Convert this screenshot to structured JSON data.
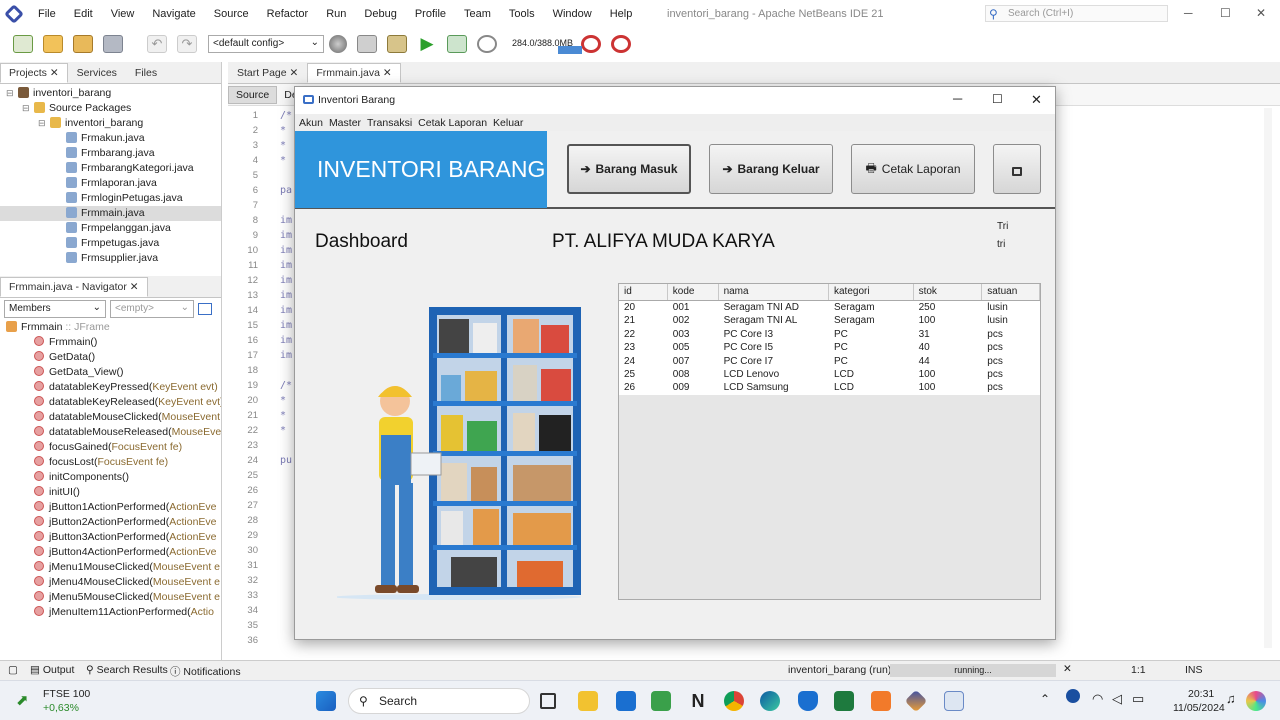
{
  "ide": {
    "menu": [
      "File",
      "Edit",
      "View",
      "Navigate",
      "Source",
      "Refactor",
      "Run",
      "Debug",
      "Profile",
      "Team",
      "Tools",
      "Window",
      "Help"
    ],
    "window_title": "inventori_barang - Apache NetBeans IDE 21",
    "search_placeholder": "Search (Ctrl+I)",
    "config": "<default config>",
    "memory": "284.0/388.0MB"
  },
  "projects_panel": {
    "tabs": [
      "Projects",
      "Services",
      "Files"
    ],
    "tree": [
      {
        "label": "inventori_barang",
        "indent": 0,
        "type": "project"
      },
      {
        "label": "Source Packages",
        "indent": 1,
        "type": "folder"
      },
      {
        "label": "inventori_barang",
        "indent": 2,
        "type": "package"
      },
      {
        "label": "Frmakun.java",
        "indent": 3,
        "type": "file"
      },
      {
        "label": "Frmbarang.java",
        "indent": 3,
        "type": "file"
      },
      {
        "label": "FrmbarangKategori.java",
        "indent": 3,
        "type": "file"
      },
      {
        "label": "Frmlaporan.java",
        "indent": 3,
        "type": "file"
      },
      {
        "label": "FrmloginPetugas.java",
        "indent": 3,
        "type": "file"
      },
      {
        "label": "Frmmain.java",
        "indent": 3,
        "type": "file",
        "selected": true
      },
      {
        "label": "Frmpelanggan.java",
        "indent": 3,
        "type": "file"
      },
      {
        "label": "Frmpetugas.java",
        "indent": 3,
        "type": "file"
      },
      {
        "label": "Frmsupplier.java",
        "indent": 3,
        "type": "file"
      }
    ]
  },
  "navigator": {
    "title": "Frmmain.java - Navigator",
    "filter": "Members",
    "empty_combo": "<empty>",
    "root": "Frmmain",
    "root_type": " :: JFrame",
    "members": [
      {
        "name": "Frmmain()",
        "arg": ""
      },
      {
        "name": "GetData()",
        "arg": ""
      },
      {
        "name": "GetData_View()",
        "arg": ""
      },
      {
        "name": "datatableKeyPressed(",
        "arg": "KeyEvent evt)"
      },
      {
        "name": "datatableKeyReleased(",
        "arg": "KeyEvent evt)"
      },
      {
        "name": "datatableMouseClicked(",
        "arg": "MouseEvent"
      },
      {
        "name": "datatableMouseReleased(",
        "arg": "MouseEve"
      },
      {
        "name": "focusGained(",
        "arg": "FocusEvent fe)"
      },
      {
        "name": "focusLost(",
        "arg": "FocusEvent fe)"
      },
      {
        "name": "initComponents()",
        "arg": ""
      },
      {
        "name": "initUI()",
        "arg": ""
      },
      {
        "name": "jButton1ActionPerformed(",
        "arg": "ActionEve"
      },
      {
        "name": "jButton2ActionPerformed(",
        "arg": "ActionEve"
      },
      {
        "name": "jButton3ActionPerformed(",
        "arg": "ActionEve"
      },
      {
        "name": "jButton4ActionPerformed(",
        "arg": "ActionEve"
      },
      {
        "name": "jMenu1MouseClicked(",
        "arg": "MouseEvent e"
      },
      {
        "name": "jMenu4MouseClicked(",
        "arg": "MouseEvent e"
      },
      {
        "name": "jMenu5MouseClicked(",
        "arg": "MouseEvent e"
      },
      {
        "name": "jMenuItem11ActionPerformed(",
        "arg": "Actio"
      }
    ]
  },
  "editor": {
    "tabs": [
      "Start Page",
      "Frmmain.java"
    ],
    "subtabs": [
      "Source",
      "De"
    ],
    "line_numbers": [
      "1",
      "2",
      "3",
      "4",
      "5",
      "6",
      "7",
      "8",
      "9",
      "10",
      "11",
      "12",
      "13",
      "14",
      "15",
      "16",
      "17",
      "18",
      "19",
      "20",
      "21",
      "22",
      "23",
      "24",
      "25",
      "26",
      "27",
      "28",
      "29",
      "30",
      "31",
      "32",
      "33",
      "34",
      "35",
      "36"
    ],
    "code": [
      "/*",
      "*",
      "*",
      "*",
      "",
      "pa",
      "",
      "im",
      "im",
      "im",
      "im",
      "im",
      "im",
      "im",
      "im",
      "im",
      "im",
      "",
      "/*",
      "*",
      "*",
      "*",
      "",
      "pu",
      "",
      "",
      "",
      "",
      "",
      "",
      "",
      "",
      "",
      "",
      "",
      ""
    ]
  },
  "app": {
    "title": "Inventori Barang",
    "menu": [
      "Akun",
      "Master",
      "Transaksi",
      "Cetak Laporan",
      "Keluar"
    ],
    "banner": "INVENTORI BARANG",
    "buttons": {
      "masuk": "Barang Masuk",
      "keluar": "Barang Keluar",
      "cetak": "Cetak Laporan"
    },
    "dashboard": "Dashboard",
    "company": "PT. ALIFYA MUDA KARYA",
    "user_name": "Tri",
    "user_login": "tri",
    "table": {
      "headers": [
        "id",
        "kode",
        "nama",
        "kategori",
        "stok",
        "satuan"
      ],
      "rows": [
        [
          "20",
          "001",
          "Seragam TNI AD",
          "Seragam",
          "250",
          "lusin"
        ],
        [
          "21",
          "002",
          "Seragam TNI AL",
          "Seragam",
          "100",
          "lusin"
        ],
        [
          "22",
          "003",
          "PC Core I3",
          "PC",
          "31",
          "pcs"
        ],
        [
          "23",
          "005",
          "PC Core I5",
          "PC",
          "40",
          "pcs"
        ],
        [
          "24",
          "007",
          "PC Core I7",
          "PC",
          "44",
          "pcs"
        ],
        [
          "25",
          "008",
          "LCD Lenovo",
          "LCD",
          "100",
          "pcs"
        ],
        [
          "26",
          "009",
          "LCD Samsung",
          "LCD",
          "100",
          "pcs"
        ]
      ]
    }
  },
  "status": {
    "output": "Output",
    "search_results": "Search Results",
    "notifications": "Notifications",
    "run_label": "inventori_barang (run)",
    "running": "running...",
    "position": "1:1",
    "mode": "INS"
  },
  "taskbar": {
    "stock_name": "FTSE 100",
    "stock_change": "+0,63%",
    "search": "Search",
    "time": "20:31",
    "date": "11/05/2024"
  }
}
